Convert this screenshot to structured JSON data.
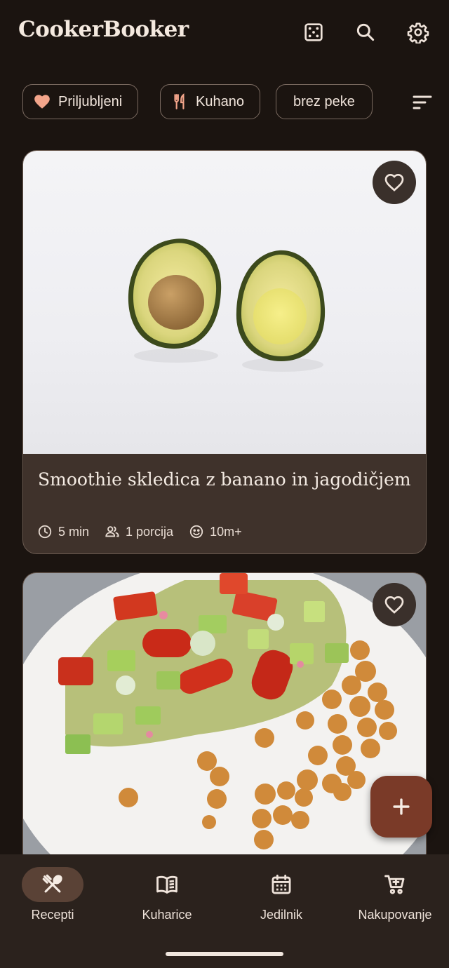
{
  "app": {
    "title": "CookerBooker"
  },
  "header_icons": [
    "dice-icon",
    "search-icon",
    "settings-icon"
  ],
  "chips": [
    {
      "label": "Priljubljeni",
      "icon": "heart-icon"
    },
    {
      "label": "Kuhano",
      "icon": "fork-knife-icon"
    },
    {
      "label": "brez peke",
      "icon": null
    }
  ],
  "recipes": [
    {
      "title": "Smoothie skledica z banano in jagodičjem",
      "time": "5 min",
      "servings": "1 porcija",
      "views": "10m+",
      "favorite": false
    },
    {
      "favorite": false
    }
  ],
  "nav": [
    {
      "label": "Recepti",
      "icon": "fork-spoon-icon",
      "active": true
    },
    {
      "label": "Kuharice",
      "icon": "book-icon",
      "active": false
    },
    {
      "label": "Jedilnik",
      "icon": "calendar-icon",
      "active": false
    },
    {
      "label": "Nakupovanje",
      "icon": "cart-icon",
      "active": false
    }
  ],
  "colors": {
    "background": "#1b1410",
    "card": "#3f322b",
    "fab": "#7a3a28",
    "nav_active": "#5a4236",
    "heart": "#f2a48a"
  }
}
